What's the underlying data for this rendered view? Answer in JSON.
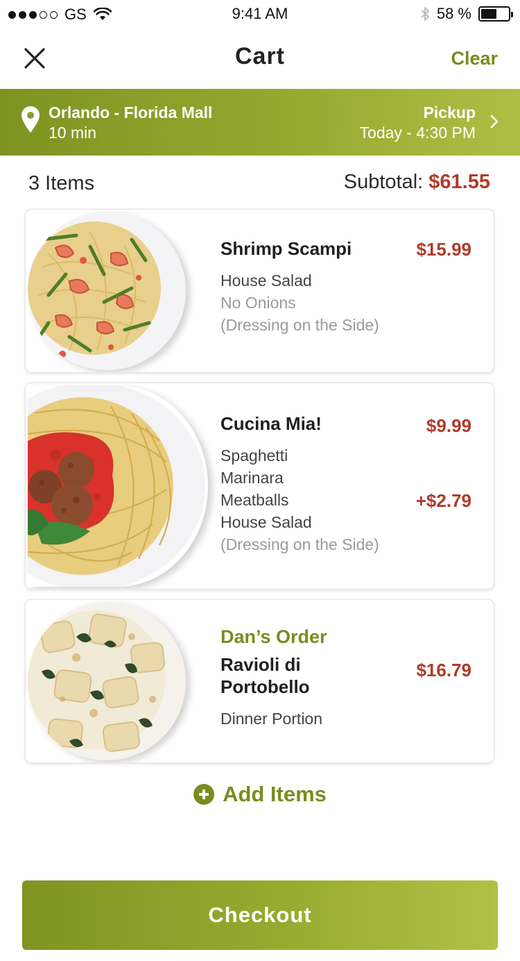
{
  "status_bar": {
    "carrier": "GS",
    "time": "9:41 AM",
    "battery_pct": "58 %",
    "battery_level": 0.58
  },
  "nav": {
    "title": "Cart",
    "clear_label": "Clear"
  },
  "banner": {
    "location": "Orlando - Florida Mall",
    "distance_time": "10 min",
    "mode": "Pickup",
    "pickup_time": "Today - 4:30 PM"
  },
  "summary": {
    "items_count": "3 Items",
    "subtotal_label": "Subtotal:",
    "subtotal_value": "$61.55"
  },
  "cart_items": [
    {
      "name": "Shrimp Scampi",
      "price": "$15.99",
      "options": [
        "House Salad"
      ],
      "muted_options": [
        "No Onions",
        "(Dressing on the Side)"
      ]
    },
    {
      "name": "Cucina Mia!",
      "price": "$9.99",
      "options": [
        "Spaghetti",
        "Marinara",
        "Meatballs",
        "House Salad"
      ],
      "muted_options": [
        "(Dressing on the Side)"
      ],
      "extra_price": "+$2.79"
    },
    {
      "guest": "Dan’s Order",
      "name_line1": "Ravioli di",
      "name_line2": "Portobello",
      "price": "$16.79",
      "options": [
        "Dinner Portion"
      ]
    }
  ],
  "add_items_label": "Add Items",
  "checkout_label": "Checkout",
  "colors": {
    "brand_green": "#7a8c1e",
    "price_red": "#b13a2a"
  }
}
